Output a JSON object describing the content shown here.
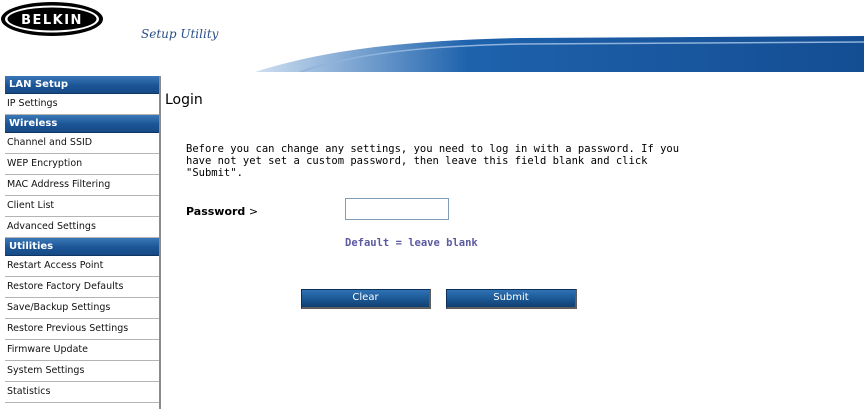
{
  "header": {
    "logo_text": "BELKIN",
    "title": "Setup Utility"
  },
  "sidebar": {
    "sections": [
      {
        "heading": "LAN Setup",
        "items": [
          "IP Settings"
        ]
      },
      {
        "heading": "Wireless",
        "items": [
          "Channel and SSID",
          "WEP Encryption",
          "MAC Address Filtering",
          "Client List",
          "Advanced Settings"
        ]
      },
      {
        "heading": "Utilities",
        "items": [
          "Restart Access Point",
          "Restore Factory Defaults",
          "Save/Backup Settings",
          "Restore Previous Settings",
          "Firmware Update",
          "System Settings",
          "Statistics"
        ]
      }
    ]
  },
  "main": {
    "title": "Login",
    "intro": "Before you can change any settings, you need to log in with a password. If you have not yet set a custom password, then leave this field blank and click \"Submit\".",
    "password_label": "Password",
    "password_arrow": ">",
    "password_value": "",
    "hint": "Default = leave blank",
    "clear_label": "Clear",
    "submit_label": "Submit"
  },
  "colors": {
    "nav_blue": "#1c5596",
    "hint_purple": "#5b5aa0"
  }
}
